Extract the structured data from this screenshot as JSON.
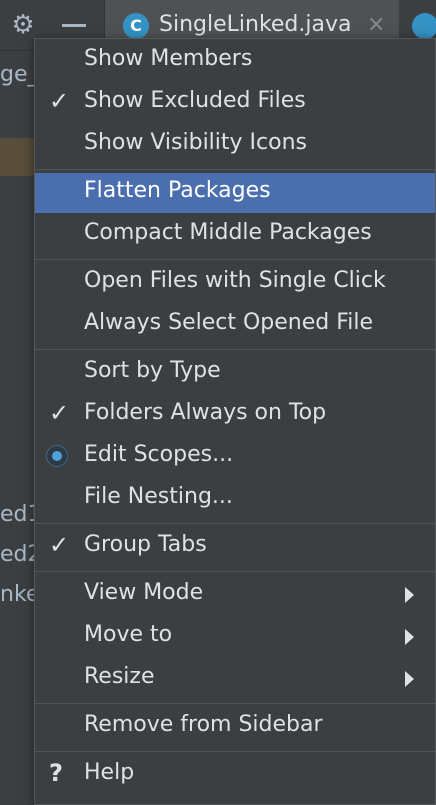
{
  "topbar": {
    "tab_label": "SingleLinked.java",
    "tab_icon_letter": "C"
  },
  "tree": {
    "partial_1": "ge_",
    "partial_2": "ed1",
    "partial_3": "ed2",
    "partial_4": "nke"
  },
  "menu": {
    "items": [
      {
        "label": "Show Members"
      },
      {
        "label": "Show Excluded Files",
        "checked": true
      },
      {
        "label": "Show Visibility Icons"
      },
      {
        "label": "Flatten Packages",
        "highlighted": true
      },
      {
        "label": "Compact Middle Packages"
      },
      {
        "label": "Open Files with Single Click"
      },
      {
        "label": "Always Select Opened File"
      },
      {
        "label": "Sort by Type"
      },
      {
        "label": "Folders Always on Top",
        "checked": true
      },
      {
        "label": "Edit Scopes...",
        "radio": true
      },
      {
        "label": "File Nesting..."
      },
      {
        "label": "Group Tabs",
        "checked": true
      },
      {
        "label": "View Mode",
        "submenu": true
      },
      {
        "label": "Move to",
        "submenu": true
      },
      {
        "label": "Resize",
        "submenu": true
      },
      {
        "label": "Remove from Sidebar"
      },
      {
        "label": "Help"
      }
    ],
    "check_glyph": "✓",
    "help_glyph": "?"
  },
  "colors": {
    "highlight": "#4b6eaf",
    "menu_bg": "#3c3f41",
    "text": "#dfe1e5"
  }
}
